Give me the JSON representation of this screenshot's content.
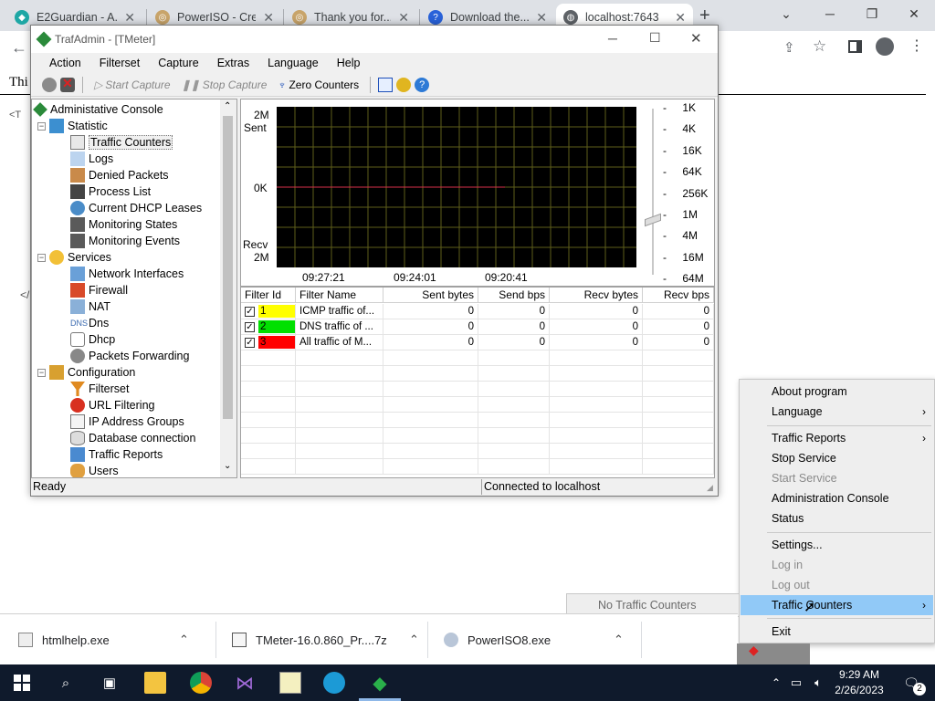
{
  "browser": {
    "tabs": [
      {
        "title": "E2Guardian - A...",
        "active": false
      },
      {
        "title": "PowerISO - Cre...",
        "active": false
      },
      {
        "title": "Thank you for...",
        "active": false
      },
      {
        "title": "Download the...",
        "active": false
      },
      {
        "title": "localhost:7643",
        "active": true
      }
    ],
    "new_tab_label": "+",
    "page_text_fragment": "Thi",
    "tree_fragment_1": "<T",
    "tree_fragment_2": "</"
  },
  "app": {
    "title": "TrafAdmin - [TMeter]",
    "menu": [
      "Action",
      "Filterset",
      "Capture",
      "Extras",
      "Language",
      "Help"
    ],
    "toolbar": {
      "start_capture": "Start Capture",
      "stop_capture": "Stop Capture",
      "zero_counters": "Zero Counters"
    },
    "tree": {
      "root": "Administative Console",
      "statistic": "Statistic",
      "statistic_items": [
        "Traffic Counters",
        "Logs",
        "Denied Packets",
        "Process List",
        "Current DHCP Leases",
        "Monitoring States",
        "Monitoring Events"
      ],
      "services": "Services",
      "services_items": [
        "Network Interfaces",
        "Firewall",
        "NAT",
        "Dns",
        "Dhcp",
        "Packets Forwarding"
      ],
      "configuration": "Configuration",
      "configuration_items": [
        "Filterset",
        "URL Filtering",
        "IP Address Groups",
        "Database connection",
        "Traffic Reports",
        "Users"
      ]
    },
    "graph": {
      "top_label": "2M",
      "sent_label": "Sent",
      "zero_label": "0K",
      "recv_label": "Recv",
      "bottom_label": "2M",
      "times": [
        "09:27:21",
        "09:24:01",
        "09:20:41"
      ],
      "scale": [
        "1K",
        "4K",
        "16K",
        "64K",
        "256K",
        "1M",
        "4M",
        "16M",
        "64M"
      ],
      "colors": {
        "background": "#000000",
        "grid": "#5e5e1a",
        "line": "#d9304a"
      }
    },
    "table": {
      "headers": [
        "Filter Id",
        "Filter Name",
        "Sent bytes",
        "Send bps",
        "Recv bytes",
        "Recv bps"
      ],
      "rows": [
        {
          "id": "1",
          "color": "#ffff00",
          "name": "ICMP traffic of...",
          "sent_bytes": "0",
          "send_bps": "0",
          "recv_bytes": "0",
          "recv_bps": "0"
        },
        {
          "id": "2",
          "color": "#00e000",
          "name": "DNS traffic of ...",
          "sent_bytes": "0",
          "send_bps": "0",
          "recv_bytes": "0",
          "recv_bps": "0"
        },
        {
          "id": "3",
          "color": "#ff0000",
          "name": "All traffic of M...",
          "sent_bytes": "0",
          "send_bps": "0",
          "recv_bytes": "0",
          "recv_bps": "0"
        }
      ]
    },
    "status": {
      "left": "Ready",
      "connection": "Connected to localhost"
    }
  },
  "context_menu": {
    "items": [
      {
        "label": "About program",
        "disabled": false,
        "submenu": false
      },
      {
        "label": "Language",
        "disabled": false,
        "submenu": true
      },
      {
        "label": "Traffic Reports",
        "disabled": false,
        "submenu": true
      },
      {
        "label": "Stop Service",
        "disabled": false,
        "submenu": false
      },
      {
        "label": "Start Service",
        "disabled": true,
        "submenu": false
      },
      {
        "label": "Administration Console",
        "disabled": false,
        "submenu": false
      },
      {
        "label": "Status",
        "disabled": false,
        "submenu": false
      },
      {
        "label": "Settings...",
        "disabled": false,
        "submenu": false
      },
      {
        "label": "Log in",
        "disabled": true,
        "submenu": false
      },
      {
        "label": "Log out",
        "disabled": true,
        "submenu": false
      },
      {
        "label": "Traffic Counters",
        "disabled": false,
        "submenu": true,
        "highlighted": true
      },
      {
        "label": "Exit",
        "disabled": false,
        "submenu": false
      }
    ],
    "submenu_text": "No Traffic Counters"
  },
  "downloads": [
    {
      "name": "htmlhelp.exe"
    },
    {
      "name": "TMeter-16.0.860_Pr....7z"
    },
    {
      "name": "PowerISO8.exe"
    }
  ],
  "taskbar": {
    "time": "9:29 AM",
    "date": "2/26/2023",
    "notifications": "2"
  }
}
